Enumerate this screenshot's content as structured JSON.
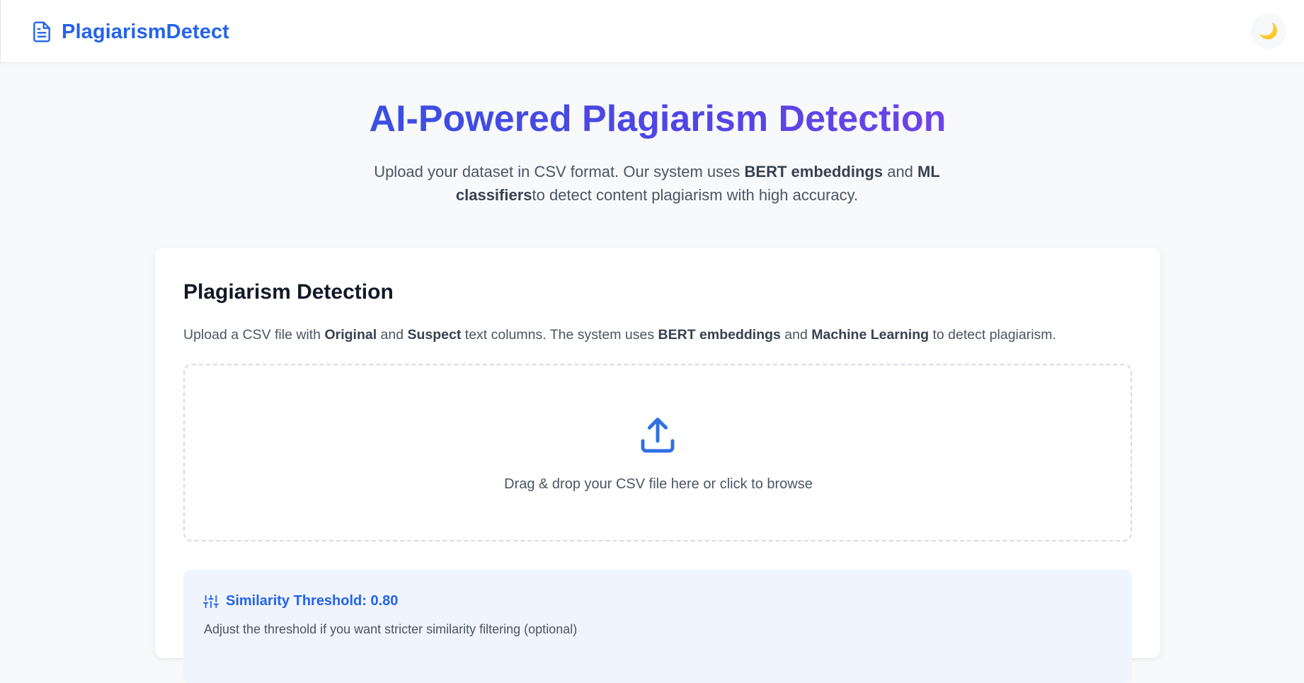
{
  "app": {
    "name": "PlagiarismDetect",
    "theme_toggle_glyph": "🌙"
  },
  "hero": {
    "title": "AI-Powered Plagiarism Detection",
    "subtitle_parts": [
      "Upload your dataset in CSV format. Our system uses ",
      "BERT embeddings",
      " and ",
      "ML classifiers",
      "to detect content plagiarism with high accuracy."
    ]
  },
  "card": {
    "title": "Plagiarism Detection",
    "description_parts": [
      "Upload a CSV file with ",
      "Original",
      " and ",
      "Suspect",
      " text columns. The system uses ",
      "BERT embeddings",
      " and ",
      "Machine Learning",
      " to detect plagiarism."
    ],
    "dropzone_text": "Drag & drop your CSV file here or click to browse",
    "threshold": {
      "label": "Similarity Threshold: 0.80",
      "value": 0.8,
      "hint": "Adjust the threshold if you want stricter similarity filtering (optional)"
    }
  },
  "icons": {
    "brand": "document-icon",
    "theme": "moon-icon",
    "upload": "upload-icon",
    "threshold": "sliders-icon"
  },
  "colors": {
    "brand": "#2563eb",
    "title_gradient_start": "#3b4fe0",
    "title_gradient_end": "#6d43e8",
    "page_bg": "#f8f9fb",
    "panel_bg": "#eff4fe"
  }
}
